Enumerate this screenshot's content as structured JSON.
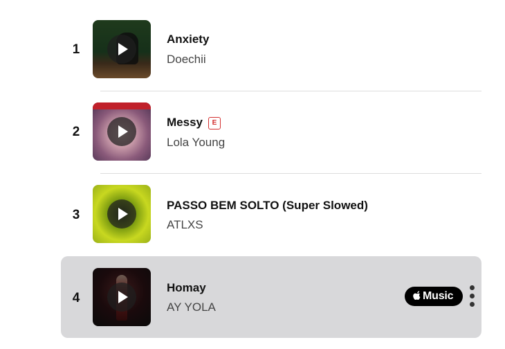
{
  "tracks": [
    {
      "rank": "1",
      "title": "Anxiety",
      "artist": "Doechii",
      "explicit": false
    },
    {
      "rank": "2",
      "title": "Messy",
      "artist": "Lola Young",
      "explicit": true,
      "explicit_label": "E"
    },
    {
      "rank": "3",
      "title": "PASSO BEM SOLTO (Super Slowed)",
      "artist": "ATLXS",
      "explicit": false
    },
    {
      "rank": "4",
      "title": "Homay",
      "artist": "AY YOLA",
      "explicit": false
    }
  ],
  "apple_music_badge": {
    "label": "Music"
  },
  "icons": {
    "play": "play-icon",
    "apple": "apple-icon",
    "more": "more-vertical-icon"
  },
  "colors": {
    "highlight_row": "#d8d8da",
    "explicit_badge": "#d32f2f",
    "badge_bg": "#000000"
  }
}
